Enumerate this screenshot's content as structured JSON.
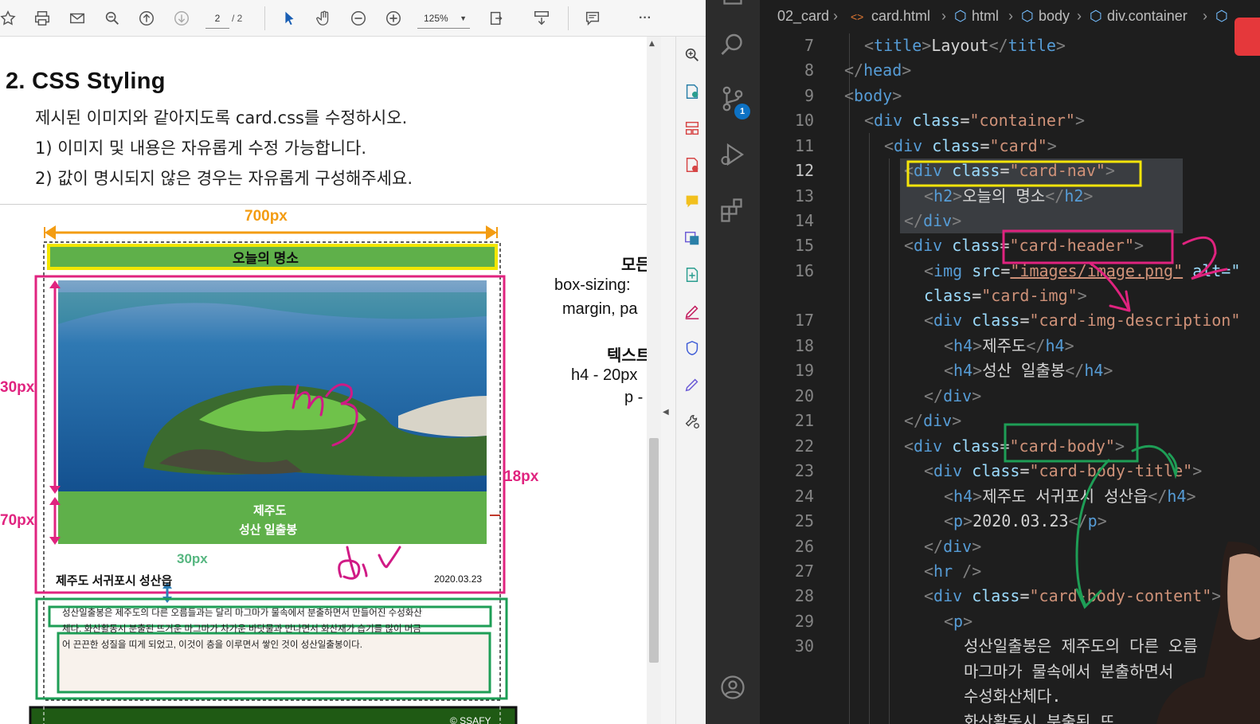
{
  "pdf_viewer": {
    "toolbar": {
      "page_current": "2",
      "page_total": "/ 2",
      "zoom": "125%",
      "more": "···"
    },
    "document": {
      "heading": "2. CSS Styling",
      "instructions": [
        "제시된 이미지와 같아지도록 card.css를 수정하시오.",
        "1)  이미지 및 내용은 자유롭게 수정 가능합니다.",
        "2)  값이 명시되지 않은 경우는 자유롭게 구성해주세요."
      ],
      "diagram": {
        "width_label": "700px",
        "nav_title": "오늘의 명소",
        "img_height_label": "30px",
        "desc_height_label": "70px",
        "right_gap_label": "18px",
        "bottom_gap_label": "30px",
        "img_caption": [
          "제주도",
          "성산 일출봉"
        ],
        "body_title": "제주도 서귀포시 성산읍",
        "body_date": "2020.03.23",
        "body_text": [
          "성산일출봉은 제주도의 다른 오름들과는 달리 마그마가 물속에서 분출하면서 만들어진 수성화산",
          "체다. 화산활동시 분출된 뜨거운 마그마가 차가운 바닷물과 만나면서 화산재가 습기를 많이 머금",
          "어 끈끈한 성질을 띠게 되었고, 이것이 층을 이루면서 쌓인 것이 성산일출봉이다."
        ],
        "footer_text": "© SSAFY",
        "annotation_img": "img",
        "annotation_div": "div"
      },
      "side_notes": [
        "모든",
        "box-sizing:",
        "margin, pa",
        "텍스트",
        "h4 - 20px",
        "p -"
      ]
    }
  },
  "vscode": {
    "breadcrumbs": [
      "02_card",
      "card.html",
      "html",
      "body",
      "div.container"
    ],
    "scm_badge": "1",
    "lines": [
      {
        "n": "7"
      },
      {
        "n": "8"
      },
      {
        "n": "9"
      },
      {
        "n": "10"
      },
      {
        "n": "11"
      },
      {
        "n": "12"
      },
      {
        "n": "13"
      },
      {
        "n": "14"
      },
      {
        "n": "15"
      },
      {
        "n": "16"
      },
      {
        "n": ""
      },
      {
        "n": "17"
      },
      {
        "n": "18"
      },
      {
        "n": "19"
      },
      {
        "n": "20"
      },
      {
        "n": "21"
      },
      {
        "n": "22"
      },
      {
        "n": "23"
      },
      {
        "n": "24"
      },
      {
        "n": "25"
      },
      {
        "n": "26"
      },
      {
        "n": "27"
      },
      {
        "n": "28"
      },
      {
        "n": "29"
      },
      {
        "n": "30"
      },
      {
        "n": ""
      },
      {
        "n": ""
      },
      {
        "n": ""
      }
    ],
    "code": {
      "l7_text": "Layout",
      "l12_cls": "\"card-nav\"",
      "l13_text": "오늘의 명소",
      "l15_cls": "\"card-header\"",
      "l16_src": "\"images/image.png\"",
      "l16_alt": "alt=\"",
      "l16b_cls": "\"card-img\"",
      "l17_cls": "\"card-img-description\"",
      "l18_text": "제주도",
      "l19_text": "성산 일출봉",
      "l22_cls": "\"card-body\"",
      "l23_cls": "\"card-body-title\"",
      "l24_text": "제주도 서귀포시 성산읍",
      "l25_text": "2020.03.23",
      "l28_cls": "\"card-body-content\"",
      "l30_text": "성산일출봉은 제주도의 다른 오름",
      "l31_text": "마그마가 물속에서 분출하면서",
      "l32_text": "수성화산체다.",
      "l33_text": "화산활동시 분출된 뜨"
    }
  }
}
